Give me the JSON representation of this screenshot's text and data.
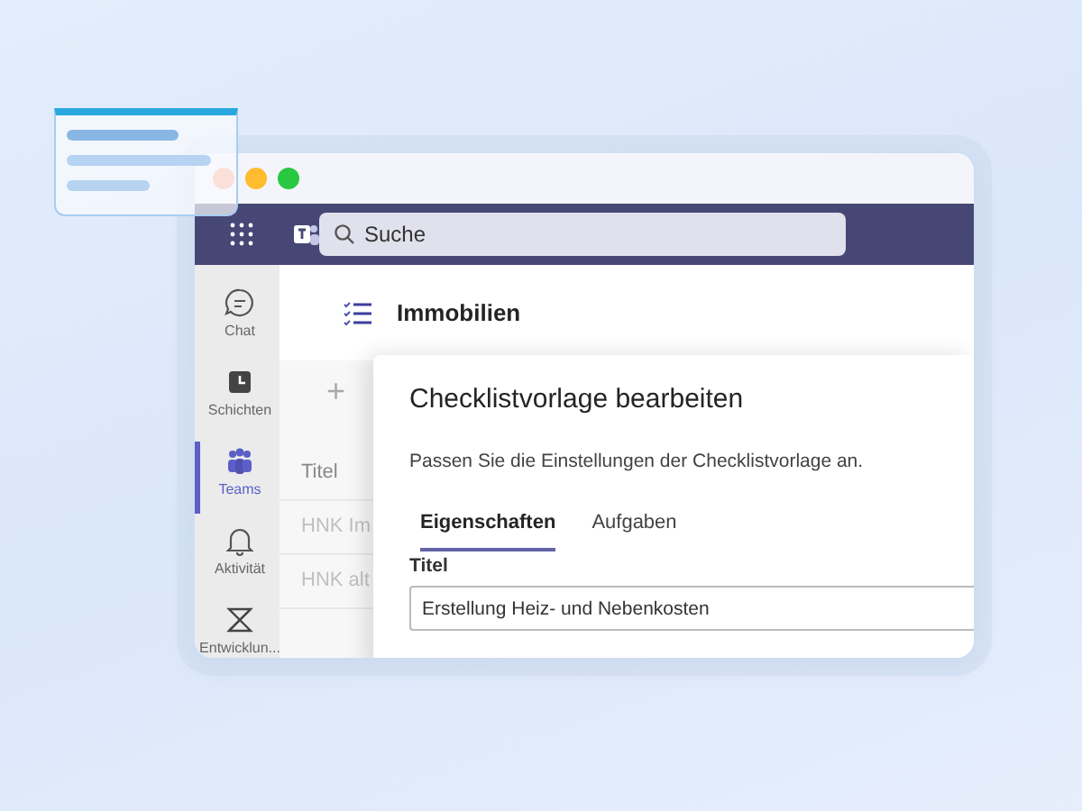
{
  "window": {
    "controls": [
      {
        "color": "#fbe0da"
      },
      {
        "color": "#febc2e"
      },
      {
        "color": "#28c840"
      }
    ]
  },
  "top_bar": {
    "search": {
      "placeholder": "Suche"
    }
  },
  "sidebar": {
    "items": [
      {
        "kind": "chat",
        "label": "Chat",
        "selected": false
      },
      {
        "kind": "shifts",
        "label": "Schichten",
        "selected": false
      },
      {
        "kind": "teams",
        "label": "Teams",
        "selected": true
      },
      {
        "kind": "activity",
        "label": "Aktivität",
        "selected": false
      },
      {
        "kind": "dev",
        "label": "Entwicklun...",
        "selected": false
      }
    ]
  },
  "content": {
    "title": "Immobilien",
    "toolbar": {
      "add": "+"
    },
    "table": {
      "columns": [
        "Titel"
      ],
      "rows": [
        "HNK Im",
        "HNK alt"
      ]
    }
  },
  "dialog": {
    "title": "Checklistvorlage bearbeiten",
    "description": "Passen Sie die Einstellungen der Checklistvorlage an.",
    "tabs": [
      {
        "label": "Eigenschaften",
        "selected": true
      },
      {
        "label": "Aufgaben",
        "selected": false
      }
    ],
    "field": {
      "label": "Titel",
      "value": "Erstellung Heiz- und Nebenkosten"
    }
  }
}
